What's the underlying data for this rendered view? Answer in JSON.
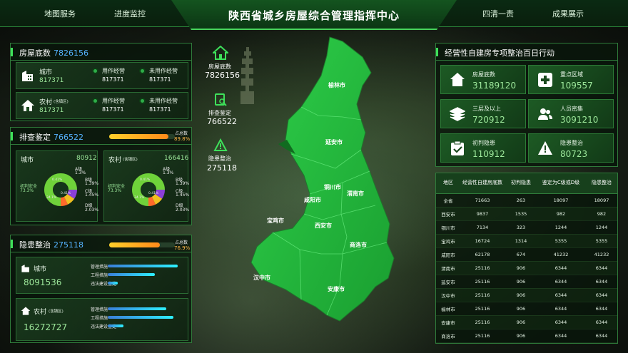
{
  "nav": {
    "left": [
      "地图服务",
      "进度监控"
    ],
    "right": [
      "四清一责",
      "成果展示"
    ],
    "title": "陕西省城乡房屋综合管理指挥中心"
  },
  "houses": {
    "title": "房屋底数",
    "total": "7826156",
    "city": {
      "label": "城市",
      "value": "817371",
      "used_label": "用作经营",
      "used": "817371",
      "unused_label": "未用作经营",
      "unused": "817371"
    },
    "rural": {
      "label": "农村",
      "sub": "(含镇区)",
      "value": "817371",
      "used_label": "用作经营",
      "used": "817371",
      "unused_label": "未用作经营",
      "unused": "817371"
    }
  },
  "inspection": {
    "title": "排查鉴定",
    "total": "766522",
    "ratio_label": "占总数",
    "ratio": "89.8%",
    "ratio_pct": 89.8,
    "city": {
      "label": "城市",
      "value": "80912",
      "safe_label": "初判安全",
      "safe": "73.3%",
      "a": "A级",
      "a_v": "1.3%",
      "b": "B级",
      "b_v": "1.39%",
      "c": "C级",
      "c_v": "1.45%",
      "d": "D级",
      "d_v": "2.03%",
      "c1": "0.41%",
      "c2": "0.41%",
      "c3": "34.1%"
    },
    "rural": {
      "label": "农村",
      "sub": "(含镇区)",
      "value": "166416",
      "safe_label": "初判安全",
      "safe": "73.3%",
      "a": "A级",
      "a_v": "1.3%",
      "b": "B级",
      "b_v": "1.39%",
      "c": "C级",
      "c_v": "1.45%",
      "d": "D级",
      "d_v": "2.03%",
      "c1": "0.41%",
      "c2": "0.41%",
      "c3": "34.1%"
    }
  },
  "hazard": {
    "title": "隐患整治",
    "total": "275118",
    "ratio_label": "占总数",
    "ratio": "76.9%",
    "ratio_pct": 76.9,
    "city": {
      "label": "城市",
      "value": "8091536",
      "bars": [
        {
          "label": "管理措施",
          "pct": 98
        },
        {
          "label": "工程措施",
          "pct": 66
        },
        {
          "label": "违法建设查处",
          "pct": 14
        }
      ]
    },
    "rural": {
      "label": "农村",
      "sub": "(含镇区)",
      "value": "16272727",
      "bars": [
        {
          "label": "管理措施",
          "pct": 82
        },
        {
          "label": "工程措施",
          "pct": 92
        },
        {
          "label": "违法建设查处",
          "pct": 22
        }
      ]
    }
  },
  "center_stats": [
    {
      "label": "房屋底数",
      "value": "7826156"
    },
    {
      "label": "排查鉴定",
      "value": "766522"
    },
    {
      "label": "隐患整治",
      "value": "275118"
    }
  ],
  "map": {
    "cities": [
      "榆林市",
      "延安市",
      "铜川市",
      "渭南市",
      "咸阳市",
      "宝鸡市",
      "西安市",
      "商洛市",
      "汉中市",
      "安康市"
    ]
  },
  "campaign": {
    "title": "经营性自建房专项整治百日行动",
    "tiles": [
      {
        "label": "房屋底数",
        "value": "31189120"
      },
      {
        "label": "重点区域",
        "value": "109557"
      },
      {
        "label": "三层及以上",
        "value": "720912"
      },
      {
        "label": "人员密集",
        "value": "3091210"
      },
      {
        "label": "初判隐患",
        "value": "110912"
      },
      {
        "label": "隐患整治",
        "value": "80723"
      }
    ]
  },
  "table": {
    "headers": [
      "地区",
      "经营性自建房底数",
      "初判隐患",
      "鉴定为C级或D级",
      "隐患整治"
    ],
    "rows": [
      [
        "全省",
        "71663",
        "263",
        "18097",
        "18097"
      ],
      [
        "西安市",
        "9837",
        "1535",
        "982",
        "982"
      ],
      [
        "铜川市",
        "7134",
        "323",
        "1244",
        "1244"
      ],
      [
        "宝鸡市",
        "16724",
        "1314",
        "5355",
        "5355"
      ],
      [
        "咸阳市",
        "62178",
        "674",
        "41232",
        "41232"
      ],
      [
        "渭南市",
        "25116",
        "906",
        "6344",
        "6344"
      ],
      [
        "延安市",
        "25116",
        "906",
        "6344",
        "6344"
      ],
      [
        "汉中市",
        "25116",
        "906",
        "6344",
        "6344"
      ],
      [
        "榆林市",
        "25116",
        "906",
        "6344",
        "6344"
      ],
      [
        "安康市",
        "25116",
        "906",
        "6344",
        "6344"
      ],
      [
        "商洛市",
        "25116",
        "906",
        "6344",
        "6344"
      ]
    ]
  },
  "colors": {
    "accent": "#3ee05a",
    "blue": "#56b3ff",
    "orange": "#ffb84a",
    "map": "#22b33c"
  }
}
